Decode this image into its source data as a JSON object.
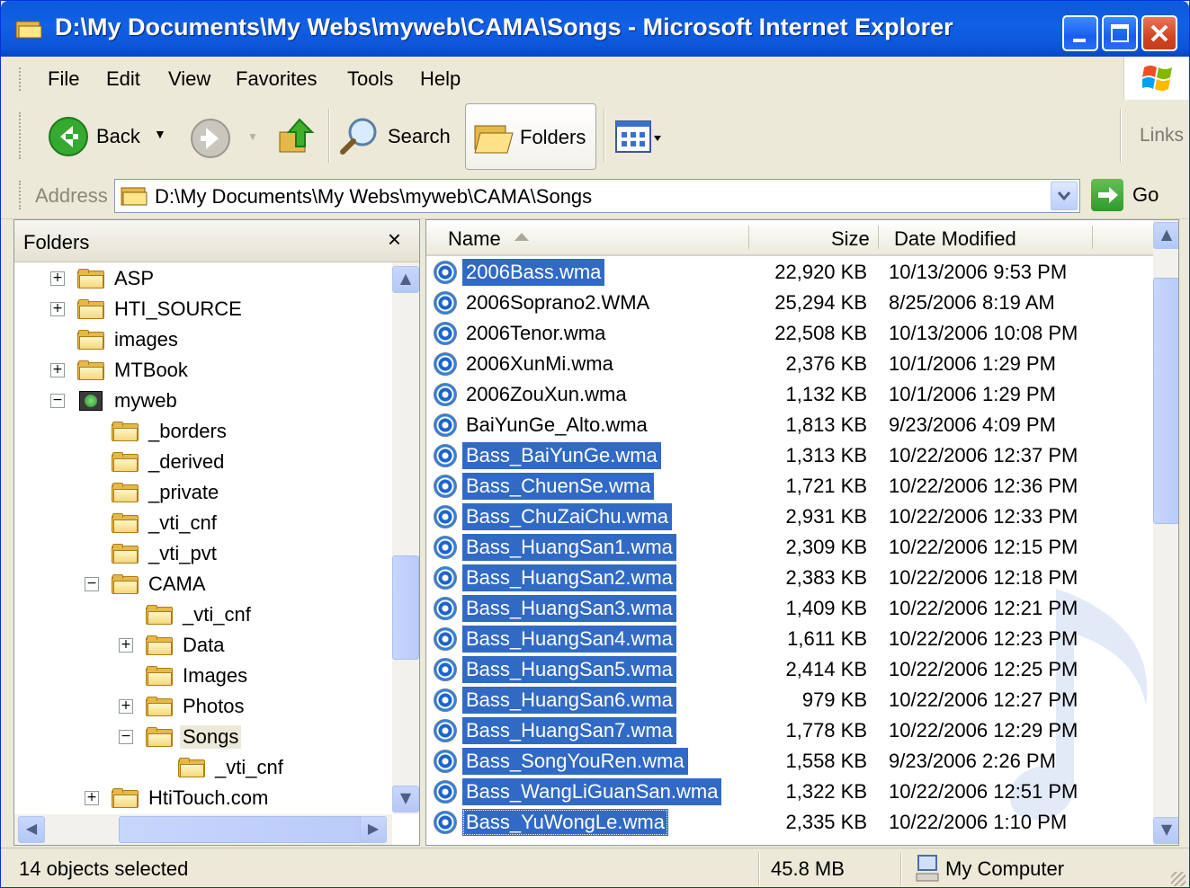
{
  "window": {
    "title": "D:\\My Documents\\My Webs\\myweb\\CAMA\\Songs - Microsoft Internet Explorer"
  },
  "menu": [
    "File",
    "Edit",
    "View",
    "Favorites",
    "Tools",
    "Help"
  ],
  "toolbar": {
    "back_label": "Back",
    "search_label": "Search",
    "folders_label": "Folders",
    "links_label": "Links"
  },
  "address": {
    "label": "Address",
    "value": "D:\\My Documents\\My Webs\\myweb\\CAMA\\Songs",
    "go_label": "Go"
  },
  "folders_pane": {
    "title": "Folders",
    "close_glyph": "×",
    "tree": [
      {
        "label": "ASP",
        "depth": 0,
        "expander": "+"
      },
      {
        "label": "HTI_SOURCE",
        "depth": 0,
        "expander": "+"
      },
      {
        "label": "images",
        "depth": 0,
        "expander": ""
      },
      {
        "label": "MTBook",
        "depth": 0,
        "expander": "+"
      },
      {
        "label": "myweb",
        "depth": 0,
        "expander": "−",
        "special": true
      },
      {
        "label": "_borders",
        "depth": 1,
        "expander": ""
      },
      {
        "label": "_derived",
        "depth": 1,
        "expander": ""
      },
      {
        "label": "_private",
        "depth": 1,
        "expander": ""
      },
      {
        "label": "_vti_cnf",
        "depth": 1,
        "expander": ""
      },
      {
        "label": "_vti_pvt",
        "depth": 1,
        "expander": ""
      },
      {
        "label": "CAMA",
        "depth": 1,
        "expander": "−"
      },
      {
        "label": "_vti_cnf",
        "depth": 2,
        "expander": ""
      },
      {
        "label": "Data",
        "depth": 2,
        "expander": "+"
      },
      {
        "label": "Images",
        "depth": 2,
        "expander": ""
      },
      {
        "label": "Photos",
        "depth": 2,
        "expander": "+"
      },
      {
        "label": "Songs",
        "depth": 2,
        "expander": "−",
        "selected": true
      },
      {
        "label": "_vti_cnf",
        "depth": 3,
        "expander": ""
      },
      {
        "label": "HtiTouch.com",
        "depth": 1,
        "expander": "+"
      }
    ]
  },
  "file_list": {
    "columns": {
      "name": "Name",
      "size": "Size",
      "date": "Date Modified"
    },
    "rows": [
      {
        "name": "2006Bass.wma",
        "size": "22,920 KB",
        "date": "10/13/2006 9:53 PM",
        "selected": true
      },
      {
        "name": "2006Soprano2.WMA",
        "size": "25,294 KB",
        "date": "8/25/2006 8:19 AM",
        "selected": false
      },
      {
        "name": "2006Tenor.wma",
        "size": "22,508 KB",
        "date": "10/13/2006 10:08 PM",
        "selected": false
      },
      {
        "name": "2006XunMi.wma",
        "size": "2,376 KB",
        "date": "10/1/2006 1:29 PM",
        "selected": false
      },
      {
        "name": "2006ZouXun.wma",
        "size": "1,132 KB",
        "date": "10/1/2006 1:29 PM",
        "selected": false
      },
      {
        "name": "BaiYunGe_Alto.wma",
        "size": "1,813 KB",
        "date": "9/23/2006 4:09 PM",
        "selected": false
      },
      {
        "name": "Bass_BaiYunGe.wma",
        "size": "1,313 KB",
        "date": "10/22/2006 12:37 PM",
        "selected": true
      },
      {
        "name": "Bass_ChuenSe.wma",
        "size": "1,721 KB",
        "date": "10/22/2006 12:36 PM",
        "selected": true
      },
      {
        "name": "Bass_ChuZaiChu.wma",
        "size": "2,931 KB",
        "date": "10/22/2006 12:33 PM",
        "selected": true
      },
      {
        "name": "Bass_HuangSan1.wma",
        "size": "2,309 KB",
        "date": "10/22/2006 12:15 PM",
        "selected": true
      },
      {
        "name": "Bass_HuangSan2.wma",
        "size": "2,383 KB",
        "date": "10/22/2006 12:18 PM",
        "selected": true
      },
      {
        "name": "Bass_HuangSan3.wma",
        "size": "1,409 KB",
        "date": "10/22/2006 12:21 PM",
        "selected": true
      },
      {
        "name": "Bass_HuangSan4.wma",
        "size": "1,611 KB",
        "date": "10/22/2006 12:23 PM",
        "selected": true
      },
      {
        "name": "Bass_HuangSan5.wma",
        "size": "2,414 KB",
        "date": "10/22/2006 12:25 PM",
        "selected": true
      },
      {
        "name": "Bass_HuangSan6.wma",
        "size": "979 KB",
        "date": "10/22/2006 12:27 PM",
        "selected": true
      },
      {
        "name": "Bass_HuangSan7.wma",
        "size": "1,778 KB",
        "date": "10/22/2006 12:29 PM",
        "selected": true
      },
      {
        "name": "Bass_SongYouRen.wma",
        "size": "1,558 KB",
        "date": "9/23/2006 2:26 PM",
        "selected": true
      },
      {
        "name": "Bass_WangLiGuanSan.wma",
        "size": "1,322 KB",
        "date": "10/22/2006 12:51 PM",
        "selected": true
      },
      {
        "name": "Bass_YuWongLe.wma",
        "size": "2,335 KB",
        "date": "10/22/2006 1:10 PM",
        "selected": true,
        "focus": true
      }
    ]
  },
  "status": {
    "selection": "14 objects selected",
    "size": "45.8 MB",
    "zone": "My Computer"
  },
  "colors": {
    "titlebar": "#0a5ce8",
    "selection": "#316ac5",
    "chrome": "#ece9d8"
  }
}
